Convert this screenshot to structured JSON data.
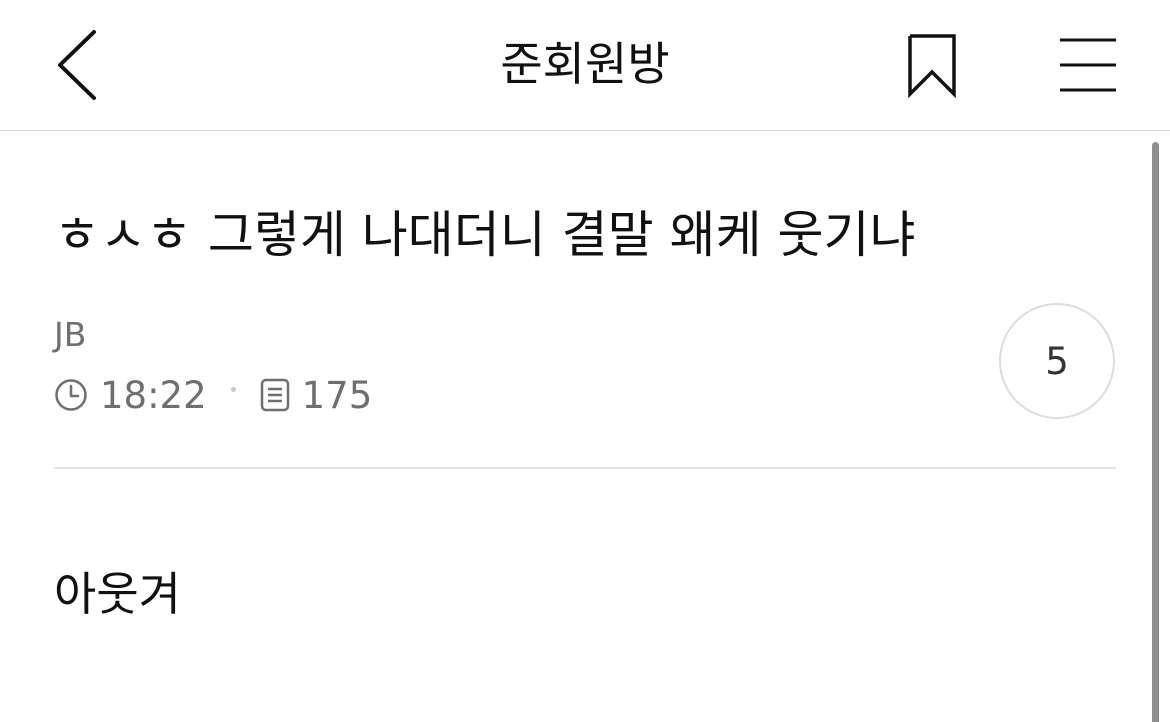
{
  "header": {
    "board_title": "준회원방"
  },
  "post": {
    "title": "ㅎㅅㅎ 그렇게 나대더니 결말 왜케 웃기냐",
    "author": "JB",
    "time": "18:22",
    "views": "175",
    "comment_count": "5",
    "body": "아웃겨"
  },
  "icons": {
    "back": "chevron-left-icon",
    "bookmark": "bookmark-icon",
    "menu": "hamburger-menu-icon",
    "time": "clock-icon",
    "views": "document-icon"
  },
  "colors": {
    "text": "#111111",
    "meta_text": "#6f6f6f",
    "divider": "#e4e4e4",
    "badge_border": "#dcdcdc"
  }
}
